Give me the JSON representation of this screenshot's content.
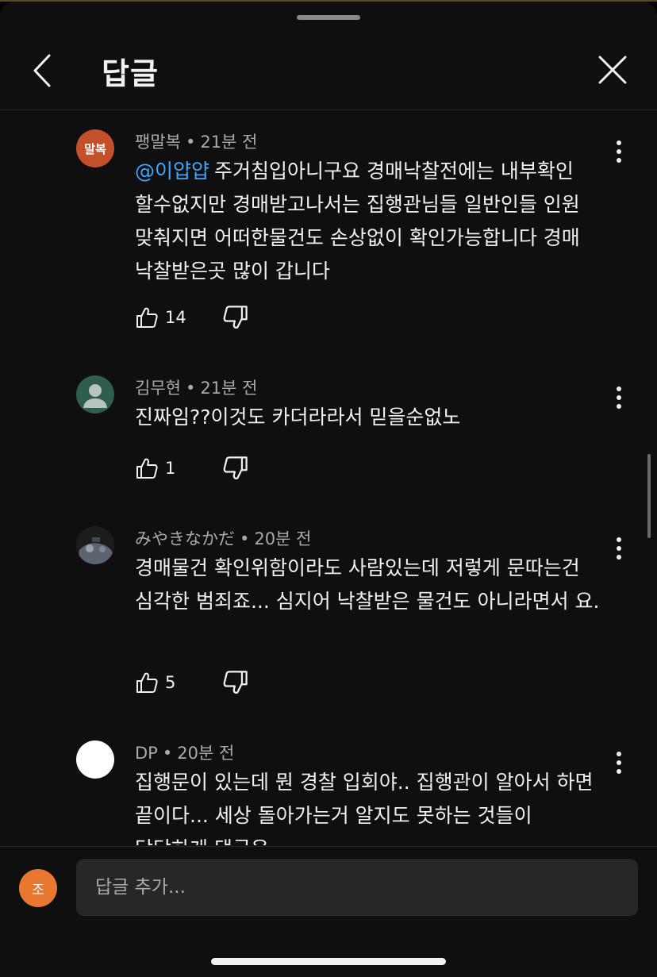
{
  "header": {
    "title": "답글"
  },
  "comments": [
    {
      "avatar_text": "말복",
      "avatar_color": "#c4502b",
      "author": "팽말복",
      "time": "21분 전",
      "mention": "@이얍얍",
      "text": "주거침입아니구요 경매낙찰전에는 내부확인 할수없지만 경매받고나서는 집행관님들 일반인들 인원 맞춰지면 어떠한물건도 손상없이 확인가능합니다 경매 낙찰받은곳 많이 갑니다",
      "likes": "14"
    },
    {
      "avatar_text": "",
      "avatar_color": "#2f5d50",
      "author": "김무현",
      "time": "21분 전",
      "mention": "",
      "text": "진짜임??이것도 카더라라서 믿을순없노",
      "likes": "1"
    },
    {
      "avatar_text": "",
      "avatar_color": "#2a2a2a",
      "author": "みやきなかだ",
      "time": "20분 전",
      "mention": "",
      "text": "경매물건 확인위함이라도 사람있는데 저렇게 문따는건 심각한 범죄죠...  심지어 낙찰받은 물건도 아니라면서 요.",
      "likes": "5"
    },
    {
      "avatar_text": "",
      "avatar_color": "#ffffff",
      "author": "DP",
      "time": "20분 전",
      "mention": "",
      "text": "집행문이 있는데 뭔 경찰 입회야.. 집행관이 알아서 하면 끝이다... 세상 돌아가는거 알지도 못하는 것들이 당당하게 댓글은",
      "likes": ""
    }
  ],
  "compose": {
    "avatar_text": "조",
    "placeholder": "답글 추가..."
  }
}
